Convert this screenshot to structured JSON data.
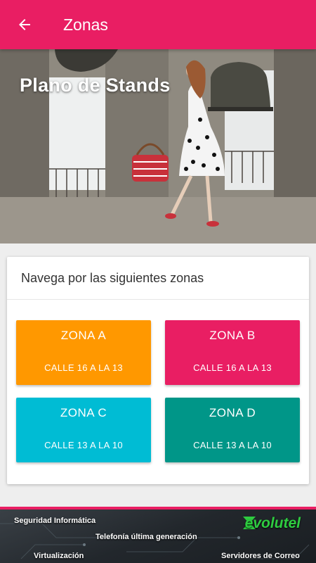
{
  "appbar": {
    "title": "Zonas"
  },
  "hero": {
    "title": "Plano de Stands"
  },
  "card": {
    "header": "Navega por las siguientes zonas",
    "zones": [
      {
        "name": "ZONA A",
        "streets": "CALLE 16 A LA 13",
        "color": "#ff9800"
      },
      {
        "name": "ZONA B",
        "streets": "CALLE 16 A LA 13",
        "color": "#e91e63"
      },
      {
        "name": "ZONA C",
        "streets": "CALLE 13 A LA 10",
        "color": "#00bcd4"
      },
      {
        "name": "ZONA D",
        "streets": "CALLE 13 A LA 10",
        "color": "#009688"
      }
    ]
  },
  "footer": {
    "items": [
      "Seguridad Informática",
      "Telefonía última generación",
      "Virtualización",
      "Servidores de Correo"
    ],
    "brand": "evolutel"
  },
  "colors": {
    "primary": "#e91e63",
    "brand_green": "#2ecc40"
  },
  "icons": {
    "back": "arrow-left-icon"
  }
}
